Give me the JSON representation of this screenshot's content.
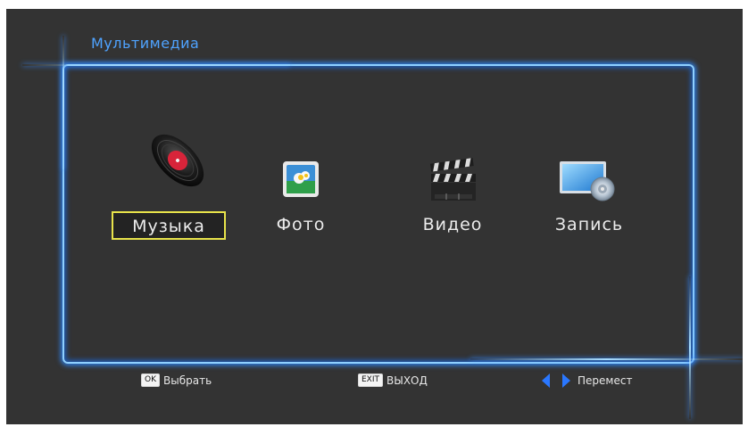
{
  "header": {
    "title": "Мультимедиа"
  },
  "menu": {
    "items": [
      {
        "label": "Музыка",
        "icon": "vinyl-record-icon",
        "selected": true
      },
      {
        "label": "Фото",
        "icon": "photo-icon",
        "selected": false
      },
      {
        "label": "Видео",
        "icon": "clapperboard-icon",
        "selected": false
      },
      {
        "label": "Запись",
        "icon": "recording-disc-icon",
        "selected": false
      }
    ]
  },
  "footer": {
    "ok_key": "OK",
    "ok_label": "Выбрать",
    "exit_key": "EXIT",
    "exit_label": "ВЫХОД",
    "move_label": "Перемест"
  },
  "colors": {
    "background": "#333333",
    "title": "#4fa3ff",
    "frame_glow": "#2e7fe8",
    "selection": "#e8e34a",
    "arrows": "#2a77ff"
  }
}
